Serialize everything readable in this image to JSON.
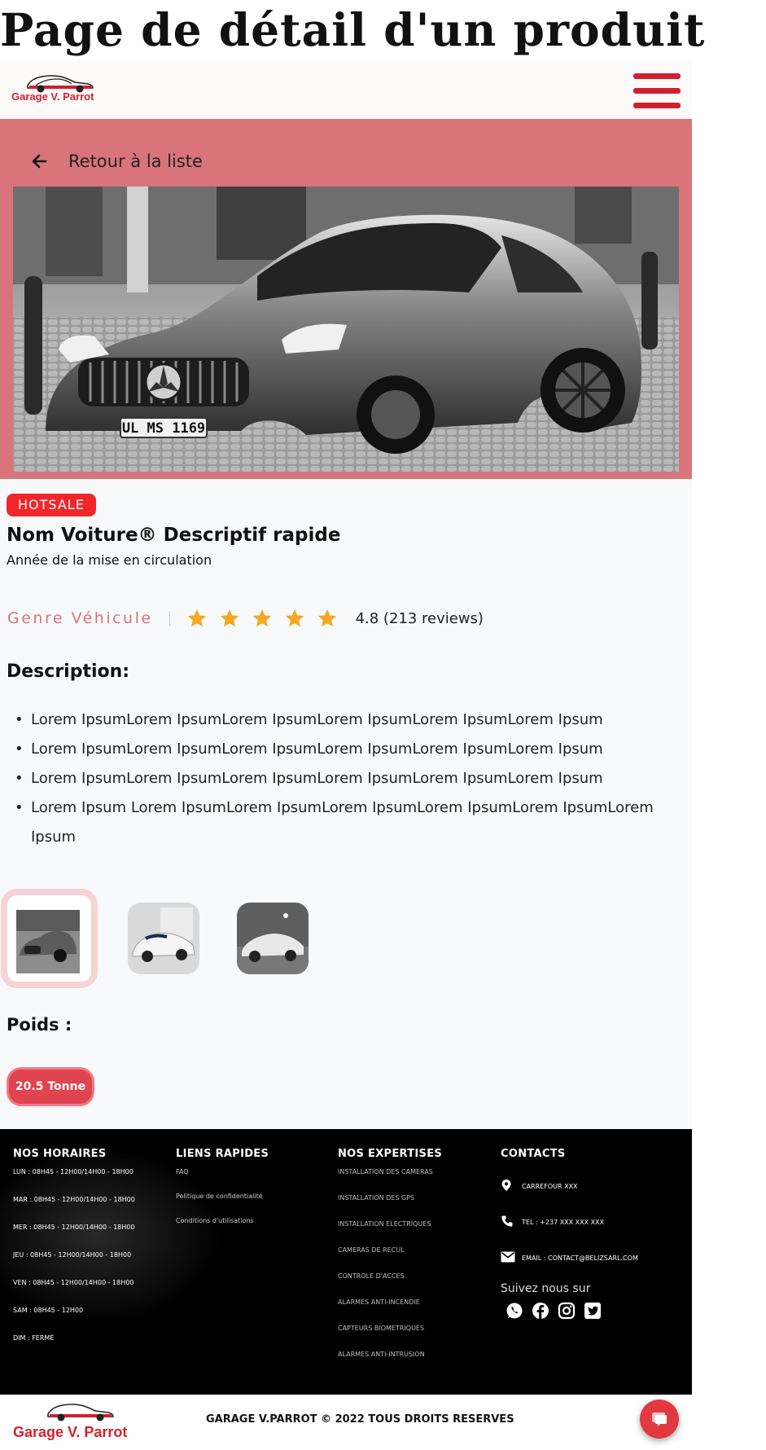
{
  "page_heading": "Page de détail d'un produit",
  "brand": {
    "name": "Garage V. Parrot"
  },
  "hero": {
    "back_label": "Retour à la liste",
    "plate": "UL MS 1169"
  },
  "product": {
    "badge": "HOTSALE",
    "title": "Nom Voiture® Descriptif rapide",
    "subtitle": "Année de la mise en circulation",
    "genre": "Genre Véhicule",
    "rating": {
      "value": 4.8,
      "max": 5,
      "text": "4.8 (213 reviews)"
    },
    "description_title": "Description:",
    "description_items": [
      "Lorem IpsumLorem IpsumLorem IpsumLorem IpsumLorem IpsumLorem Ipsum",
      "Lorem IpsumLorem IpsumLorem IpsumLorem IpsumLorem IpsumLorem Ipsum",
      "Lorem IpsumLorem IpsumLorem IpsumLorem IpsumLorem IpsumLorem Ipsum",
      "Lorem Ipsum Lorem IpsumLorem IpsumLorem IpsumLorem IpsumLorem IpsumLorem Ipsum"
    ],
    "poids_title": "Poids :",
    "weight": "20.5 Tonne"
  },
  "footer": {
    "hours": {
      "title": "NOS HORAIRES",
      "items": [
        "LUN  : 08H45 - 12H00/14H00 - 18H00",
        "MAR : 08H45 - 12H00/14H00 - 18H00",
        "MER : 08H45 - 12H00/14H00 - 18H00",
        "JEU  : 08H45 - 12H00/14H00 - 18H00",
        "VEN  : 08H45 - 12H00/14H00 - 18H00",
        "SAM : 08H45 - 12H00",
        "DIM  : FERMÉ"
      ]
    },
    "links": {
      "title": "LIENS RAPIDES",
      "items": [
        "FAQ",
        "Politique de confidentialité",
        "Conditions d'utilisations"
      ]
    },
    "expertises": {
      "title": "NOS EXPERTISES",
      "items": [
        "INSTALLATION DES CAMERAS",
        "INSTALLATION DES GPS",
        "INSTALLATION ELECTRIQUES",
        "CAMERAS DE RECUL",
        "CONTROLE D'ACCES",
        "ALARMES ANTI-INCENDIE",
        "CAPTEURS BIOMETRIQUES",
        "ALARMES ANTI-INTRUSION"
      ]
    },
    "contacts": {
      "title": "CONTACTS",
      "address": "CARREFOUR XXX",
      "phone": "TEL : +237 XXX XXX XXX",
      "email": "EMAIL : CONTACT@BELIZSARL.COM",
      "follow": "Suivez nous sur"
    },
    "copyright": "GARAGE V.PARROT © 2022 TOUS DROITS RESERVES"
  },
  "colors": {
    "brand_red": "#d21f2f",
    "hero_bg": "#d9757a",
    "badge_red": "#f0262a",
    "star": "#f6a821"
  },
  "icons": [
    "menu-icon",
    "arrow-left-icon",
    "star-icon",
    "map-pin-icon",
    "phone-icon",
    "mail-icon",
    "whatsapp-icon",
    "facebook-icon",
    "instagram-icon",
    "twitter-icon",
    "chat-icon"
  ]
}
